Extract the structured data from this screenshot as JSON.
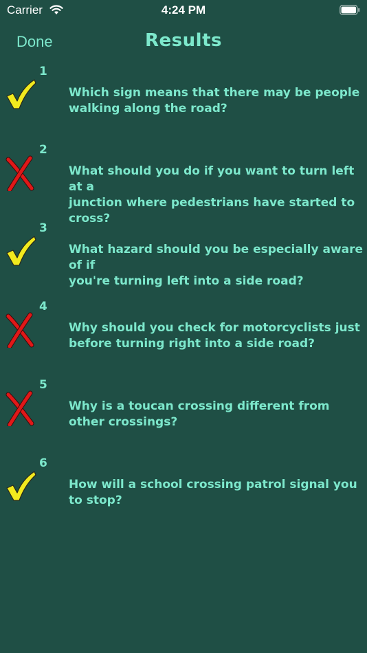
{
  "status_bar": {
    "carrier": "Carrier",
    "time": "4:24 PM"
  },
  "nav": {
    "done_label": "Done",
    "title": "Results"
  },
  "colors": {
    "background": "#1f4f45",
    "accent": "#7de8cc",
    "correct": "#f2ea1e",
    "incorrect": "#e01818"
  },
  "results": [
    {
      "number": "1",
      "correct": true,
      "question": "Which sign means that there may be people\nwalking along the road?"
    },
    {
      "number": "2",
      "correct": false,
      "question": "What should you do if you want to turn left at a\njunction where pedestrians have started to\ncross?"
    },
    {
      "number": "3",
      "correct": true,
      "question": "What hazard should you be especially aware of if\nyou're turning left into a side road?"
    },
    {
      "number": "4",
      "correct": false,
      "question": "Why should you check for motorcyclists just\nbefore turning right into a side road?"
    },
    {
      "number": "5",
      "correct": false,
      "question": "Why is a toucan crossing different from\nother crossings?"
    },
    {
      "number": "6",
      "correct": true,
      "question": "How will a school crossing patrol signal you\nto stop?"
    }
  ]
}
